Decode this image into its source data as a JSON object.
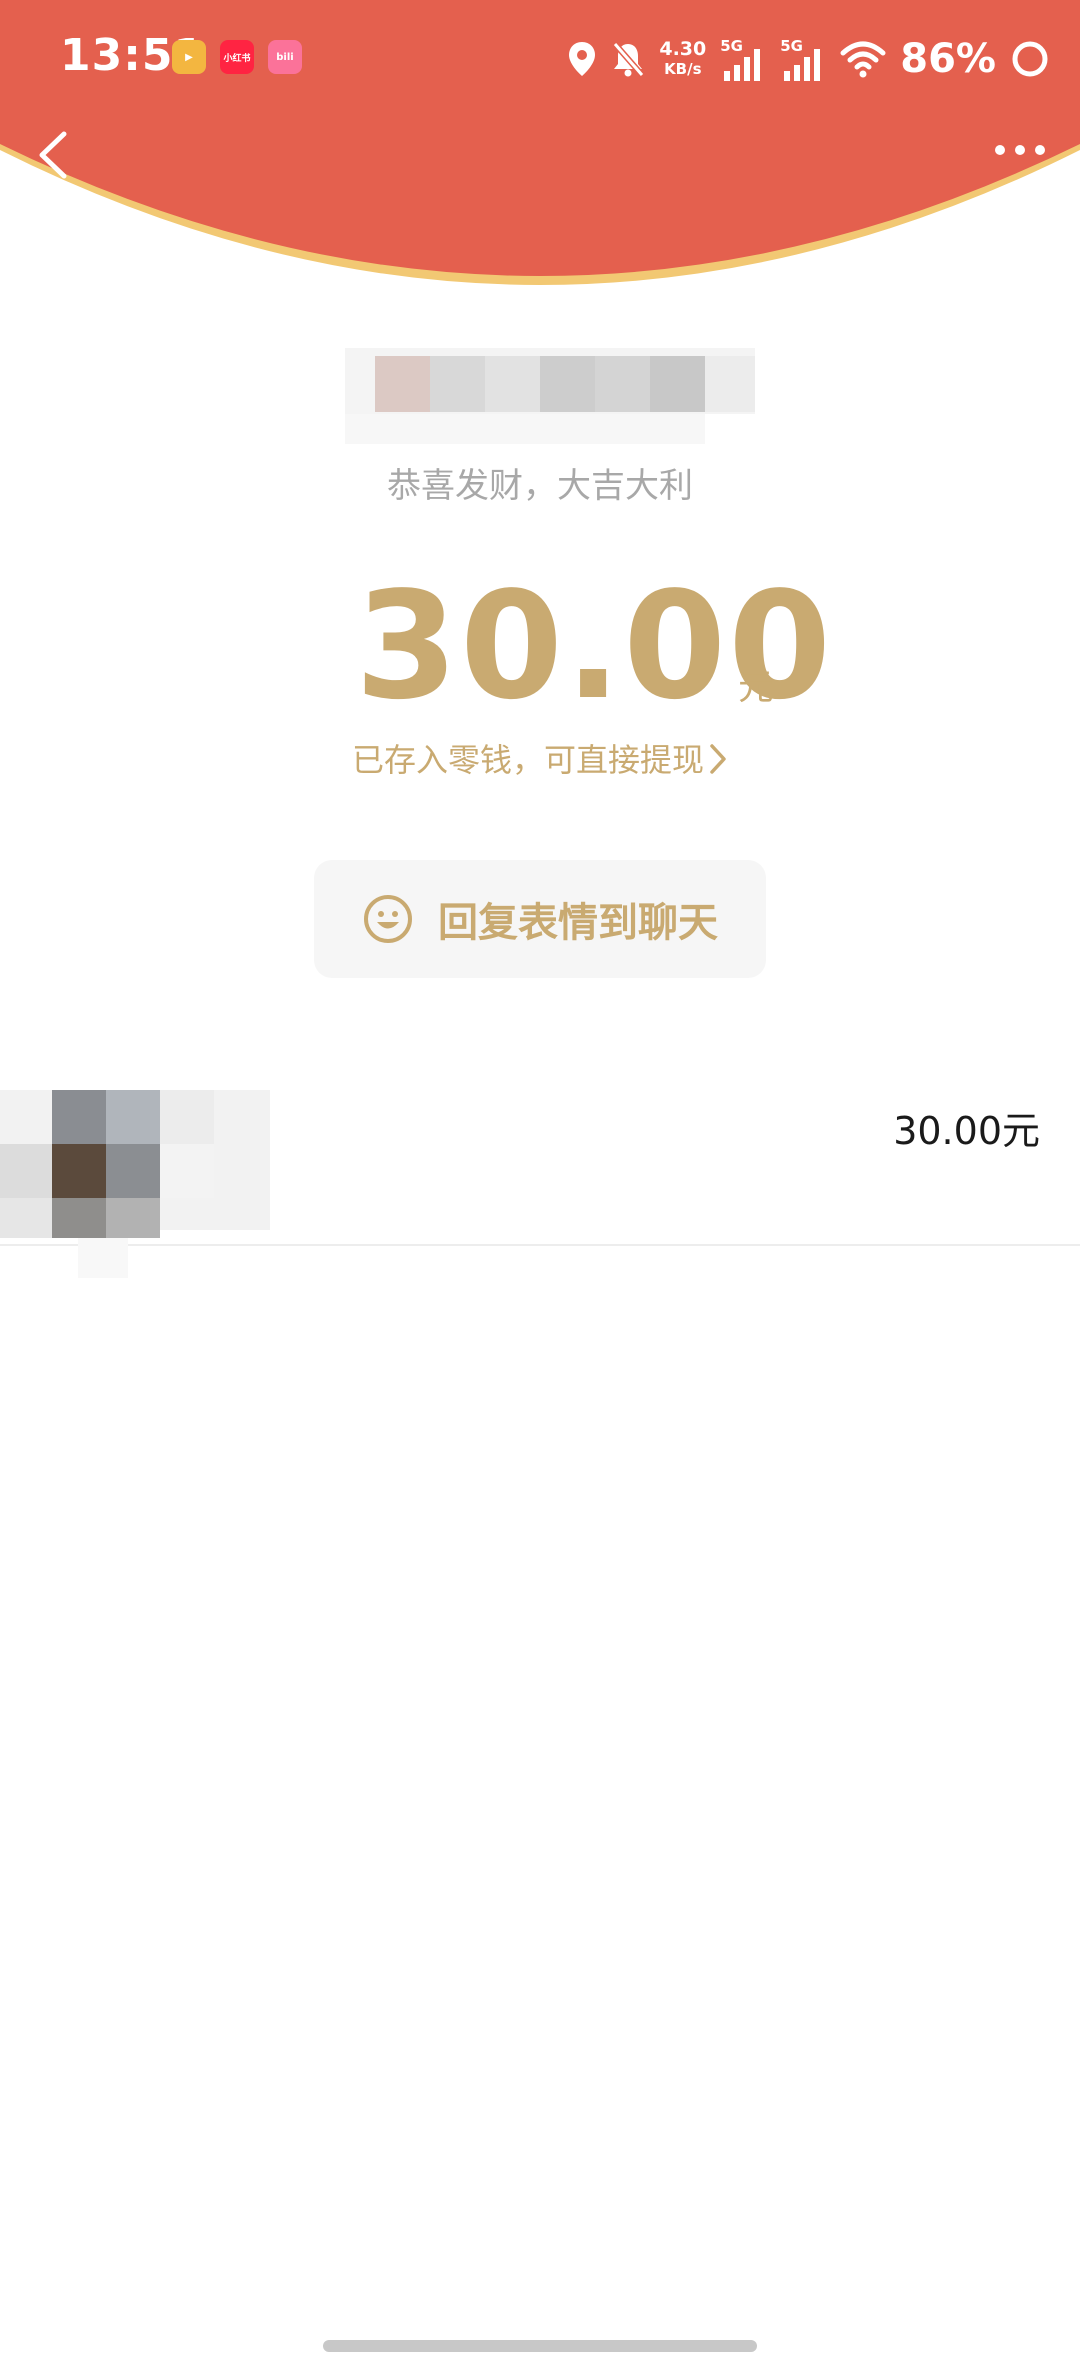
{
  "status_bar": {
    "time": "13:51",
    "net_speed_value": "4.30",
    "net_speed_unit": "KB/s",
    "sim1_label": "5G",
    "sim2_label": "5G",
    "battery": "86%"
  },
  "app_icons": [
    "video-app-icon",
    "xiaohongshu-app-icon",
    "bilibili-app-icon"
  ],
  "app_icon_texts": [
    "▶",
    "小红书",
    "bili"
  ],
  "header": {
    "back_icon": "chevron-left-icon",
    "more_icon": "more-horizontal-icon"
  },
  "red_packet": {
    "greeting": "恭喜发财，大吉大利",
    "amount": "30.00",
    "currency": "元",
    "deposit_text": "已存入零钱，可直接提现",
    "reply_label": "回复表情到聊天",
    "reply_icon": "smile-icon"
  },
  "records": [
    {
      "amount": "30.00元"
    }
  ],
  "colors": {
    "header_red": "#e4604e",
    "header_rim": "#f2c873",
    "gold": "#c9aa71",
    "greeting_gray": "#a8a8a8"
  }
}
